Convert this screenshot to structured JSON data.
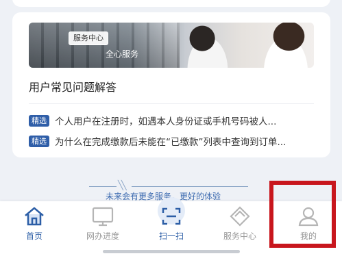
{
  "banner": {
    "tag": "服务中心",
    "subtitle": "全心服务"
  },
  "faq": {
    "title": "用户常见问题解答",
    "items": [
      {
        "badge": "精选",
        "text": "个人用户在注册时，如遇本人身份证或手机号码被人..."
      },
      {
        "badge": "精选",
        "text": "为什么在完成缴款后未能在“已缴款”列表中查询到订单..."
      }
    ]
  },
  "promo": {
    "text": "未来会有更多服务，更好的体验"
  },
  "tabbar": {
    "items": [
      {
        "label": "首页",
        "icon": "home-icon",
        "active": true
      },
      {
        "label": "网办进度",
        "icon": "monitor-icon",
        "active": false
      },
      {
        "label": "扫一扫",
        "icon": "scan-icon",
        "active": true
      },
      {
        "label": "服务中心",
        "icon": "diamond-icon",
        "active": false
      },
      {
        "label": "我的",
        "icon": "user-icon",
        "active": false
      }
    ]
  },
  "colors": {
    "accent": "#2c5ea6",
    "badge": "#2f5ea8",
    "highlight": "#c8161d"
  }
}
